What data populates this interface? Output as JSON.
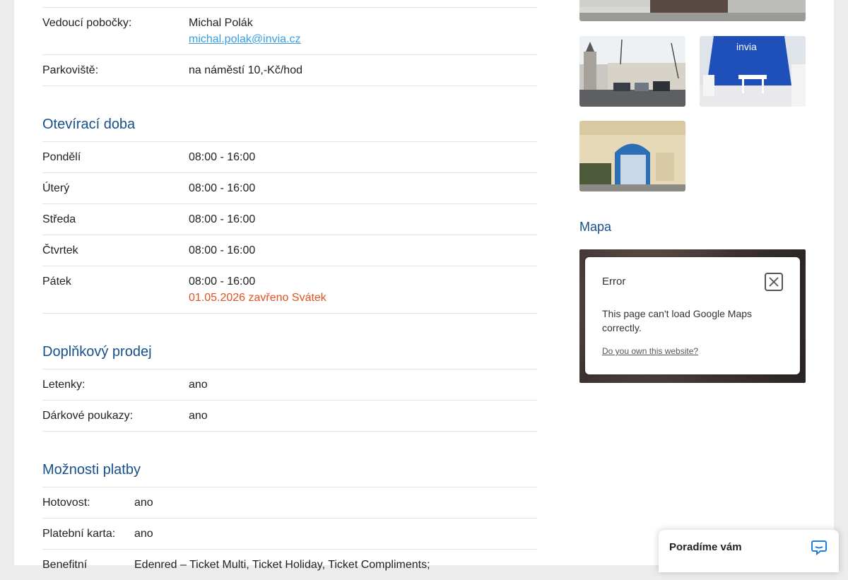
{
  "branch": {
    "manager_label": "Vedoucí pobočky:",
    "manager_name": "Michal Polák",
    "manager_email": "michal.polak@invia.cz",
    "parking_label": "Parkoviště:",
    "parking_value": "na náměstí 10,-Kč/hod"
  },
  "opening_hours": {
    "title": "Otevírací doba",
    "days": [
      {
        "day": "Pondělí",
        "hours": "08:00 - 16:00"
      },
      {
        "day": "Úterý",
        "hours": "08:00 - 16:00"
      },
      {
        "day": "Středa",
        "hours": "08:00 - 16:00"
      },
      {
        "day": "Čtvrtek",
        "hours": "08:00 - 16:00"
      },
      {
        "day": "Pátek",
        "hours": "08:00 - 16:00",
        "note": "01.05.2026 zavřeno Svátek"
      }
    ]
  },
  "additional_sales": {
    "title": "Doplňkový prodej",
    "items": [
      {
        "label": "Letenky:",
        "value": "ano"
      },
      {
        "label": "Dárkové poukazy:",
        "value": "ano"
      }
    ]
  },
  "payment": {
    "title": "Možnosti platby",
    "items": [
      {
        "label": "Hotovost:",
        "value": "ano"
      },
      {
        "label": "Platební karta:",
        "value": "ano"
      },
      {
        "label": "Benefitní",
        "value": "Edenred – Ticket Multi, Ticket Holiday, Ticket Compliments;"
      }
    ]
  },
  "map": {
    "title": "Mapa",
    "error_title": "Error",
    "error_message": "This page can't load Google Maps correctly.",
    "error_link": "Do you own this website?"
  },
  "chat": {
    "label": "Poradíme vám"
  },
  "colors": {
    "heading": "#16508c",
    "link": "#3a9ee0",
    "holiday": "#e0531f",
    "chat_icon": "#1e7fe0"
  }
}
